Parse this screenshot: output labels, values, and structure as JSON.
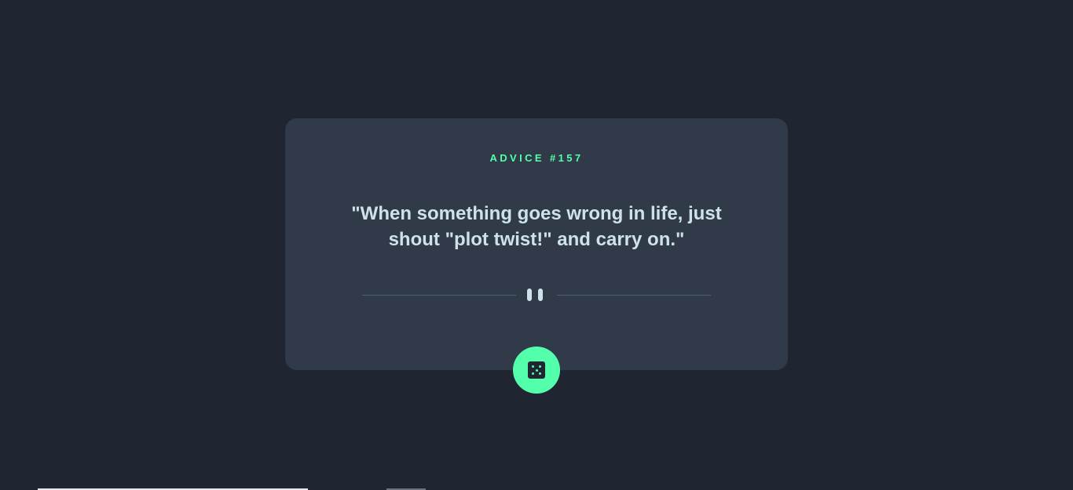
{
  "advice": {
    "id_label": "ADVICE #157",
    "text": "\"When something goes wrong in life, just shout \"plot twist!\" and carry on.\""
  },
  "icons": {
    "divider": "pause-icon",
    "button": "dice-icon"
  },
  "colors": {
    "background": "#1f2631",
    "card": "#313a48",
    "accent": "#53ffaa",
    "text": "#cee3e9"
  }
}
